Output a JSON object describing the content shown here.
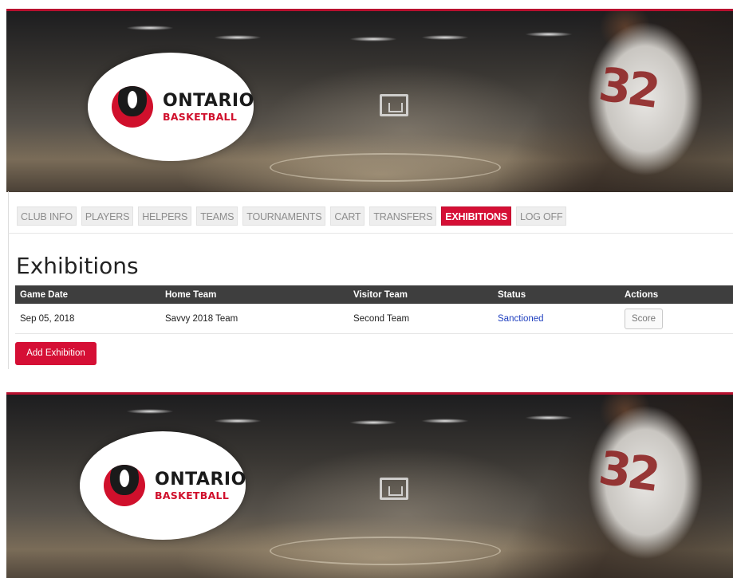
{
  "banner": {
    "logo_line1": "ONTARIO",
    "logo_line2": "BASKETBALL",
    "jersey_number": "32",
    "logo_icon": "ontario-basketball-logo-icon"
  },
  "nav": {
    "items": [
      {
        "label": "CLUB INFO",
        "active": false
      },
      {
        "label": "PLAYERS",
        "active": false
      },
      {
        "label": "HELPERS",
        "active": false
      },
      {
        "label": "TEAMS",
        "active": false
      },
      {
        "label": "TOURNAMENTS",
        "active": false
      },
      {
        "label": "CART",
        "active": false
      },
      {
        "label": "TRANSFERS",
        "active": false
      },
      {
        "label": "EXHIBITIONS",
        "active": true
      },
      {
        "label": "LOG OFF",
        "active": false
      }
    ]
  },
  "page": {
    "title": "Exhibitions"
  },
  "table": {
    "headers": [
      "Game Date",
      "Home Team",
      "Visitor Team",
      "Status",
      "Actions"
    ],
    "rows": [
      {
        "game_date": "Sep 05, 2018",
        "home_team": "Savvy 2018 Team",
        "visitor_team": "Second Team",
        "status": "Sanctioned",
        "action": "Score"
      }
    ]
  },
  "actions": {
    "add_label": "Add Exhibition"
  },
  "colors": {
    "accent": "#d50f35",
    "header_bg": "#3e3e3e",
    "link": "#1f3fbf"
  }
}
